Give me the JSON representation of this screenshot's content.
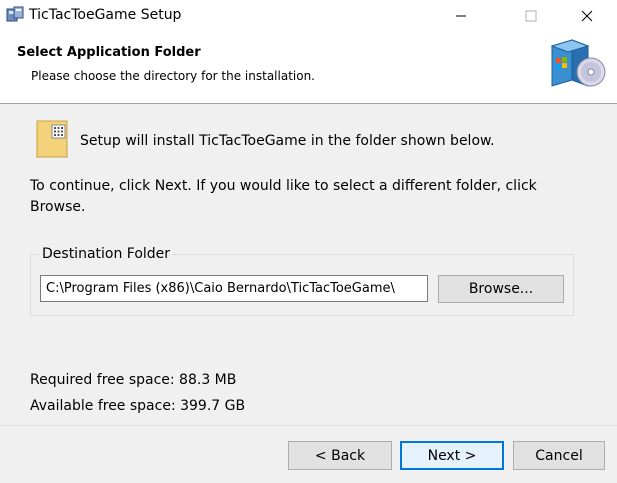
{
  "window": {
    "title": "TicTacToeGame Setup",
    "controls": [
      "minimize-icon",
      "maximize-icon",
      "close-icon"
    ]
  },
  "header": {
    "title": "Select Application Folder",
    "subtitle": "Please choose the directory for the installation."
  },
  "body": {
    "intro": "Setup will install TicTacToeGame in the folder shown below.",
    "instructions": "To continue, click Next. If you would like to select a different folder, click Browse.",
    "destination": {
      "group_label": "Destination Folder",
      "path": "C:\\Program Files (x86)\\Caio Bernardo\\TicTacToeGame\\",
      "browse_label": "Browse..."
    },
    "required_space": "Required free space: 88.3 MB",
    "available_space": "Available free space: 399.7 GB"
  },
  "footer": {
    "back_label": "< Back",
    "next_label": "Next >",
    "cancel_label": "Cancel"
  },
  "colors": {
    "accent": "#0078d7",
    "background": "#f0f0f0",
    "button": "#e1e1e1"
  }
}
